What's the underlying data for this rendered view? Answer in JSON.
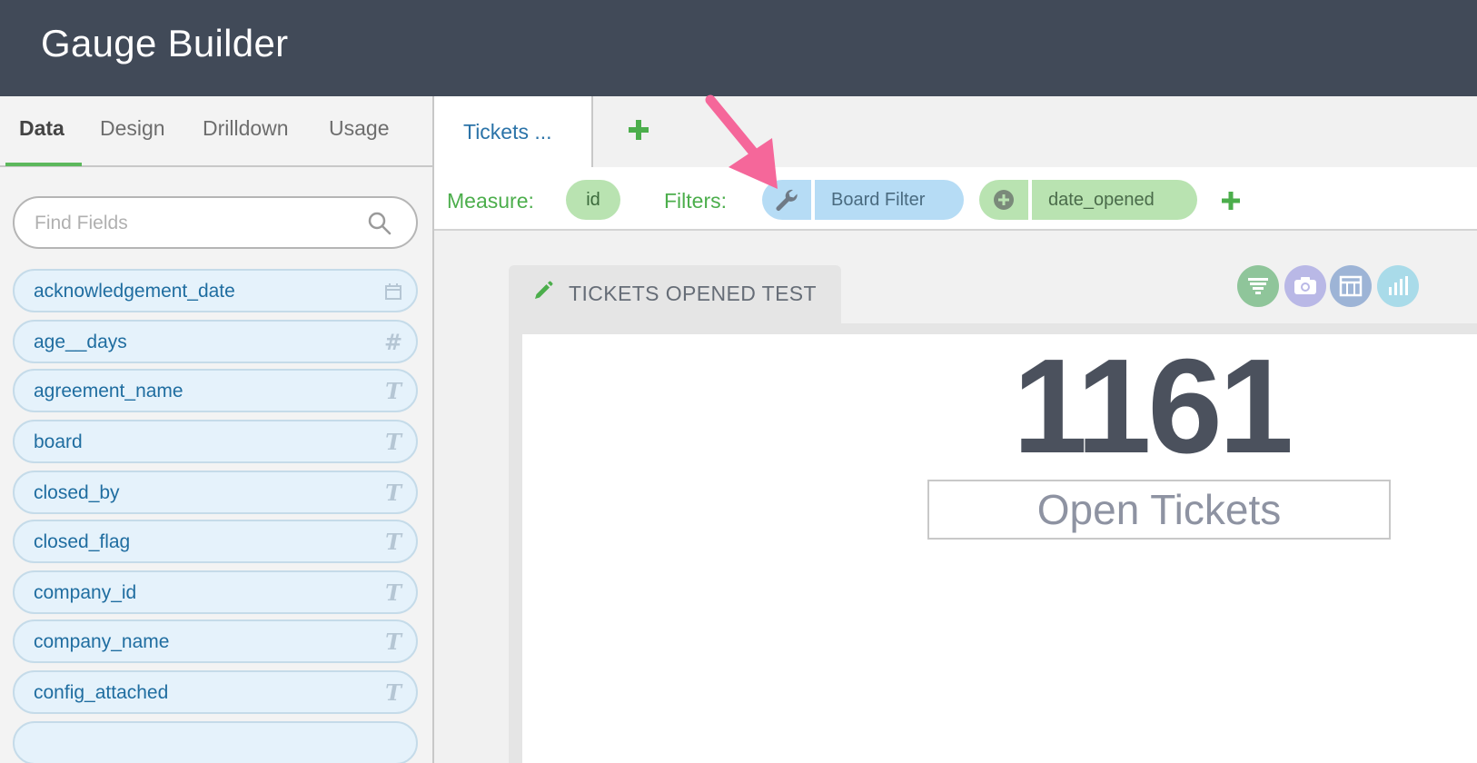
{
  "app": {
    "title": "Gauge Builder"
  },
  "sidebar": {
    "tabs": [
      {
        "label": "Data",
        "active": true
      },
      {
        "label": "Design",
        "active": false
      },
      {
        "label": "Drilldown",
        "active": false
      },
      {
        "label": "Usage",
        "active": false
      }
    ],
    "search": {
      "placeholder": "Find Fields",
      "icon": "search-icon"
    },
    "fields": [
      {
        "label": "acknowledgement_date",
        "type": "calendar-icon"
      },
      {
        "label": "age__days",
        "type": "hash-icon"
      },
      {
        "label": "agreement_name",
        "type": "text-type-icon"
      },
      {
        "label": "board",
        "type": "text-type-icon"
      },
      {
        "label": "closed_by",
        "type": "text-type-icon"
      },
      {
        "label": "closed_flag",
        "type": "text-type-icon"
      },
      {
        "label": "company_id",
        "type": "text-type-icon"
      },
      {
        "label": "company_name",
        "type": "text-type-icon"
      },
      {
        "label": "config_attached",
        "type": "text-type-icon"
      }
    ]
  },
  "main": {
    "tabs": [
      {
        "label": "Tickets ..."
      }
    ],
    "config": {
      "measure_label": "Measure:",
      "measure_value": "id",
      "filters_label": "Filters:",
      "filters": [
        {
          "label": "Board Filter",
          "icon": "wrench-icon"
        },
        {
          "label": "date_opened",
          "icon": "plus-circle-icon"
        }
      ]
    },
    "widget": {
      "title": "TICKETS OPENED TEST",
      "value": "1161",
      "label": "Open Tickets"
    },
    "toolbar": [
      {
        "name": "funnel-icon",
        "color": "#8fc59a"
      },
      {
        "name": "camera-icon",
        "color": "#b9b8e6"
      },
      {
        "name": "table-icon",
        "color": "#9db4d6"
      },
      {
        "name": "bar-chart-icon",
        "color": "#a9dbe9"
      }
    ]
  },
  "colors": {
    "header_bg": "#414a58",
    "accent_green": "#4cae4c",
    "field_blue": "#1f6da0",
    "annotation_arrow": "#f5679a"
  }
}
